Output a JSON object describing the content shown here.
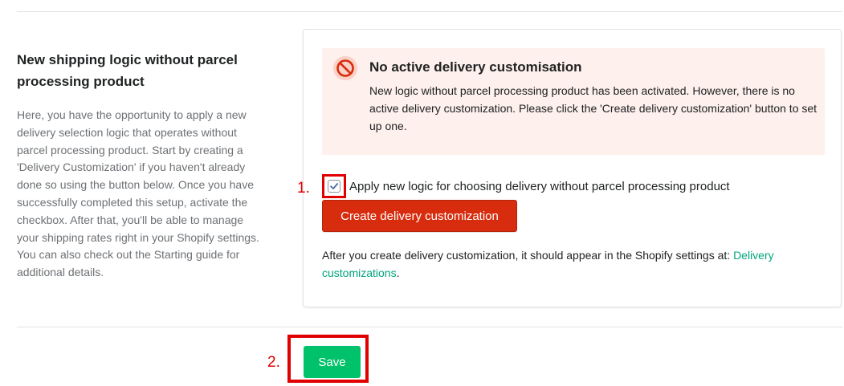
{
  "section": {
    "title": "New shipping logic without parcel processing product",
    "description": "Here, you have the opportunity to apply a new delivery selection logic that operates without parcel processing product. Start by creating a 'Delivery Customization' if you haven't already done so using the button below. Once you have successfully completed this setup, activate the checkbox. After that, you'll be able to manage your shipping rates right in your Shopify settings. You can also check out the Starting guide for additional details."
  },
  "banner": {
    "icon": "no-entry-icon",
    "title": "No active delivery customisation",
    "text": "New logic without parcel processing product has been activated. However, there is no active delivery customization. Please click the 'Create delivery customization' button to set up one."
  },
  "checkbox": {
    "label": "Apply new logic for choosing delivery without parcel processing product",
    "checked": true
  },
  "create_button": {
    "label": "Create delivery customization"
  },
  "after_text": {
    "prefix": "After you create delivery customization, it should appear in the Shopify settings at: ",
    "link": "Delivery customizations",
    "suffix": "."
  },
  "save_button": {
    "label": "Save"
  },
  "annotations": {
    "first": "1.",
    "second": "2."
  },
  "colors": {
    "critical": "#d72c0d",
    "banner_bg": "#fdf0ed",
    "save": "#00c26a",
    "link": "#00a47c",
    "annotation": "#e00000"
  }
}
